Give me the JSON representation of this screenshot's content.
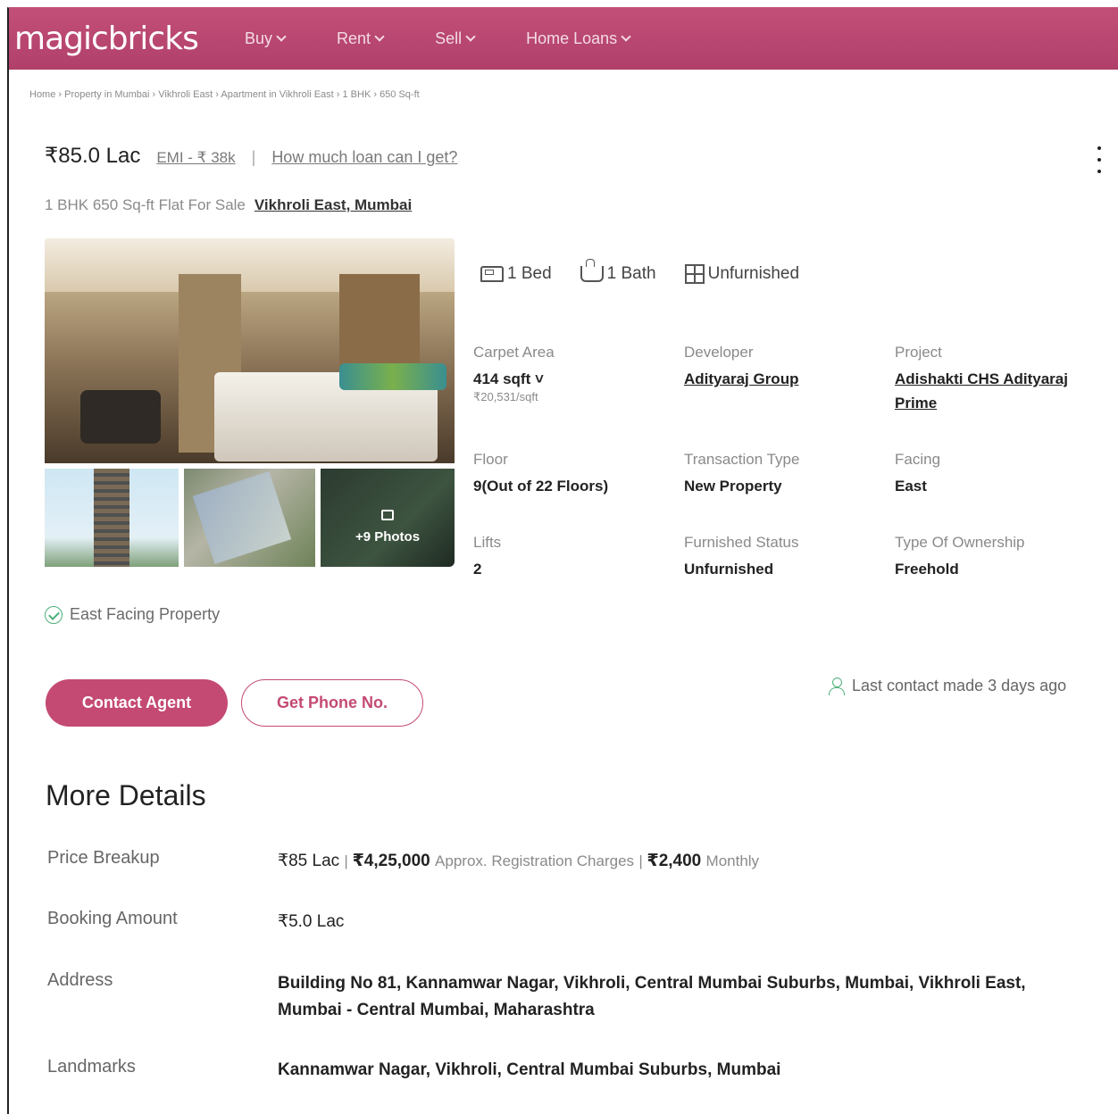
{
  "nav": {
    "logo": "magicbricks",
    "items": [
      "Buy",
      "Rent",
      "Sell",
      "Home Loans"
    ]
  },
  "breadcrumb": "Home › Property in Mumbai › Vikhroli East › Apartment in Vikhroli East › 1 BHK › 650 Sq-ft",
  "listing": {
    "price": "₹85.0 Lac",
    "emi": "EMI - ₹ 38k",
    "separator": "|",
    "loan_link": "How much loan can I get?",
    "subtitle": "1 BHK 650 Sq-ft Flat For Sale",
    "location": "Vikhroli East, Mumbai"
  },
  "gallery": {
    "more_photos": "+9 Photos"
  },
  "summary": {
    "bed": "1 Bed",
    "bath": "1 Bath",
    "furnishing": "Unfurnished"
  },
  "details": {
    "carpet_area_label": "Carpet Area",
    "carpet_area_value": "414 sqft ˅",
    "carpet_area_rate": "₹20,531/sqft",
    "developer_label": "Developer",
    "developer_value": "Adityaraj Group",
    "project_label": "Project",
    "project_value": "Adishakti CHS Adityaraj Prime",
    "floor_label": "Floor",
    "floor_value": "9(Out of 22 Floors)",
    "transaction_label": "Transaction Type",
    "transaction_value": "New Property",
    "facing_label": "Facing",
    "facing_value": "East",
    "lifts_label": "Lifts",
    "lifts_value": "2",
    "furnished_label": "Furnished Status",
    "furnished_value": "Unfurnished",
    "ownership_label": "Type Of Ownership",
    "ownership_value": "Freehold"
  },
  "feature": "East Facing Property",
  "actions": {
    "contact_agent": "Contact Agent",
    "get_phone": "Get Phone No.",
    "last_contact": "Last contact made 3 days ago"
  },
  "more_details": {
    "title": "More Details",
    "price_breakup_label": "Price Breakup",
    "price_breakup_price": "₹85 Lac",
    "price_breakup_reg": "₹4,25,000",
    "price_breakup_reg_note": "Approx. Registration Charges",
    "price_breakup_monthly": "₹2,400",
    "price_breakup_monthly_note": "Monthly",
    "booking_label": "Booking Amount",
    "booking_value": "₹5.0 Lac",
    "address_label": "Address",
    "address_value": "Building No 81, Kannamwar Nagar, Vikhroli, Central Mumbai Suburbs, Mumbai, Vikhroli East, Mumbai - Central Mumbai, Maharashtra",
    "landmarks_label": "Landmarks",
    "landmarks_value": "Kannamwar Nagar, Vikhroli, Central Mumbai Suburbs, Mumbai"
  },
  "colors": {
    "brand": "#b8456d",
    "accent_button": "#c44a73",
    "success": "#4caf7a"
  }
}
